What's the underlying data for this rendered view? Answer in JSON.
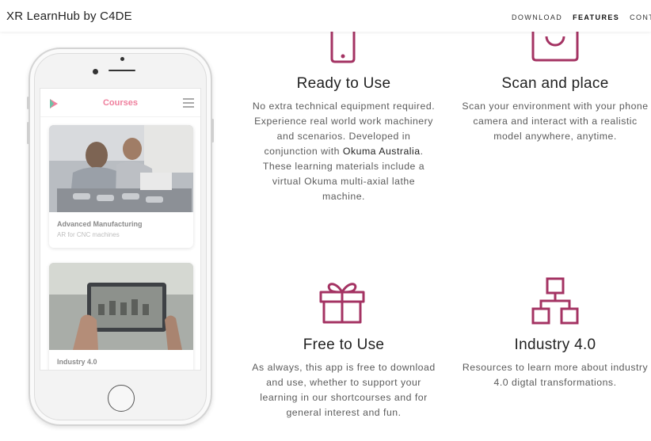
{
  "brand": "XR LearnHub by C4DE",
  "nav": {
    "download": "DOWNLOAD",
    "features": "FEATURES",
    "contact": "CONTAC"
  },
  "colors": {
    "accent": "#a43363",
    "course_title": "#ef7f9d"
  },
  "phone": {
    "app_title": "Courses",
    "courses": [
      {
        "title": "Advanced Manufacturing",
        "subtitle": "AR for CNC machines"
      },
      {
        "title": "Industry 4.0",
        "subtitle": ""
      }
    ]
  },
  "features": [
    {
      "icon": "smartphone-icon",
      "title": "Ready to Use",
      "text_before": "No extra technical equipment required. Experience real world work machinery and scenarios. Developed in conjunction with ",
      "link": "Okuma Australia",
      "text_after": ". These learning materials include a virtual Okuma multi-axial lathe machine."
    },
    {
      "icon": "camera-icon",
      "title": "Scan and place",
      "text": "Scan your environment with your phone camera and interact with a realistic model anywhere, anytime."
    },
    {
      "icon": "gift-icon",
      "title": "Free to Use",
      "text": "As always, this app is free to download and use, whether to support your learning in our shortcourses and for general interest and fun."
    },
    {
      "icon": "sitemap-icon",
      "title": "Industry 4.0",
      "text": "Resources to learn more about industry 4.0 digtal transformations."
    }
  ]
}
